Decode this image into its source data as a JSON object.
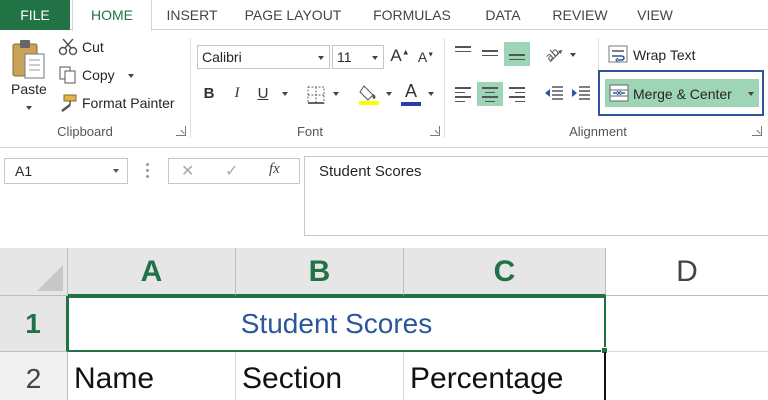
{
  "tabs": [
    "FILE",
    "HOME",
    "INSERT",
    "PAGE LAYOUT",
    "FORMULAS",
    "DATA",
    "REVIEW",
    "VIEW"
  ],
  "clipboard": {
    "paste": "Paste",
    "cut": "Cut",
    "copy": "Copy",
    "format_painter": "Format Painter",
    "label": "Clipboard"
  },
  "font": {
    "name": "Calibri",
    "size": "11",
    "bold": "B",
    "italic": "I",
    "underline": "U",
    "grow": "A",
    "shrink": "A",
    "color_letter": "A",
    "label": "Font"
  },
  "alignment": {
    "wrap_text": "Wrap Text",
    "merge_center": "Merge & Center",
    "label": "Alignment"
  },
  "formula_bar": {
    "name_box": "A1",
    "fx": "fx",
    "content": "Student Scores"
  },
  "grid": {
    "columns": [
      "A",
      "B",
      "C",
      "D"
    ],
    "rows": [
      "1",
      "2"
    ],
    "merged_title": "Student Scores",
    "row2": [
      "Name",
      "Section",
      "Percentage",
      ""
    ]
  },
  "colors": {
    "excel_green": "#217346",
    "active_fill": "#9fd5b7",
    "highlight_border": "#2b579a",
    "title_text": "#2b579a"
  }
}
